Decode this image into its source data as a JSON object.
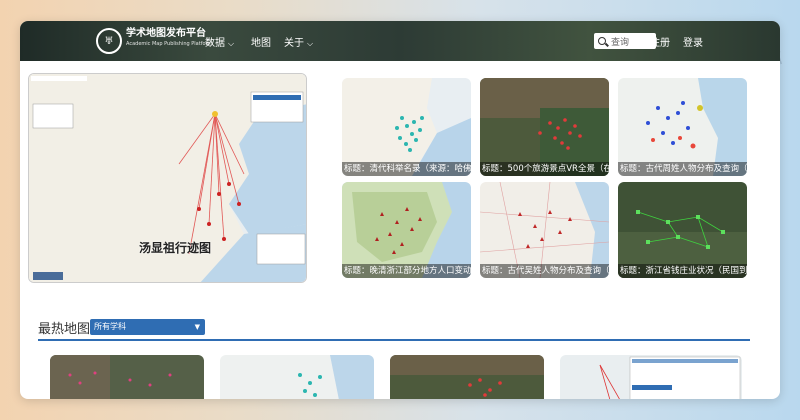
{
  "header": {
    "logo_text": "♅",
    "title": "学术地图发布平台",
    "subtitle": "Academic Map Publishing Platform",
    "nav": [
      {
        "label": "数据",
        "has_dropdown": true
      },
      {
        "label": "地图",
        "has_dropdown": false
      },
      {
        "label": "关于",
        "has_dropdown": true
      }
    ],
    "search_placeholder": "查询",
    "register": "注册",
    "login": "登录"
  },
  "featured": {
    "label": "汤显祖行迹图"
  },
  "tiles": [
    {
      "caption": "标题：清代科举名录（来源：哈佛"
    },
    {
      "caption": "标题：500个旅游景点VR全景（在"
    },
    {
      "caption": "标题：古代周姓人物分布及查询（"
    },
    {
      "caption": "标题：晚清浙江部分地方人口变动"
    },
    {
      "caption": "标题：古代吴姓人物分布及查询（"
    },
    {
      "caption": "标题：浙江省钱庄业状况（民国到解"
    }
  ],
  "hot": {
    "title": "最热地图",
    "filter": "所有学科"
  },
  "colors": {
    "accent": "#2f6db3",
    "nav_bg": "#2d3b35"
  }
}
